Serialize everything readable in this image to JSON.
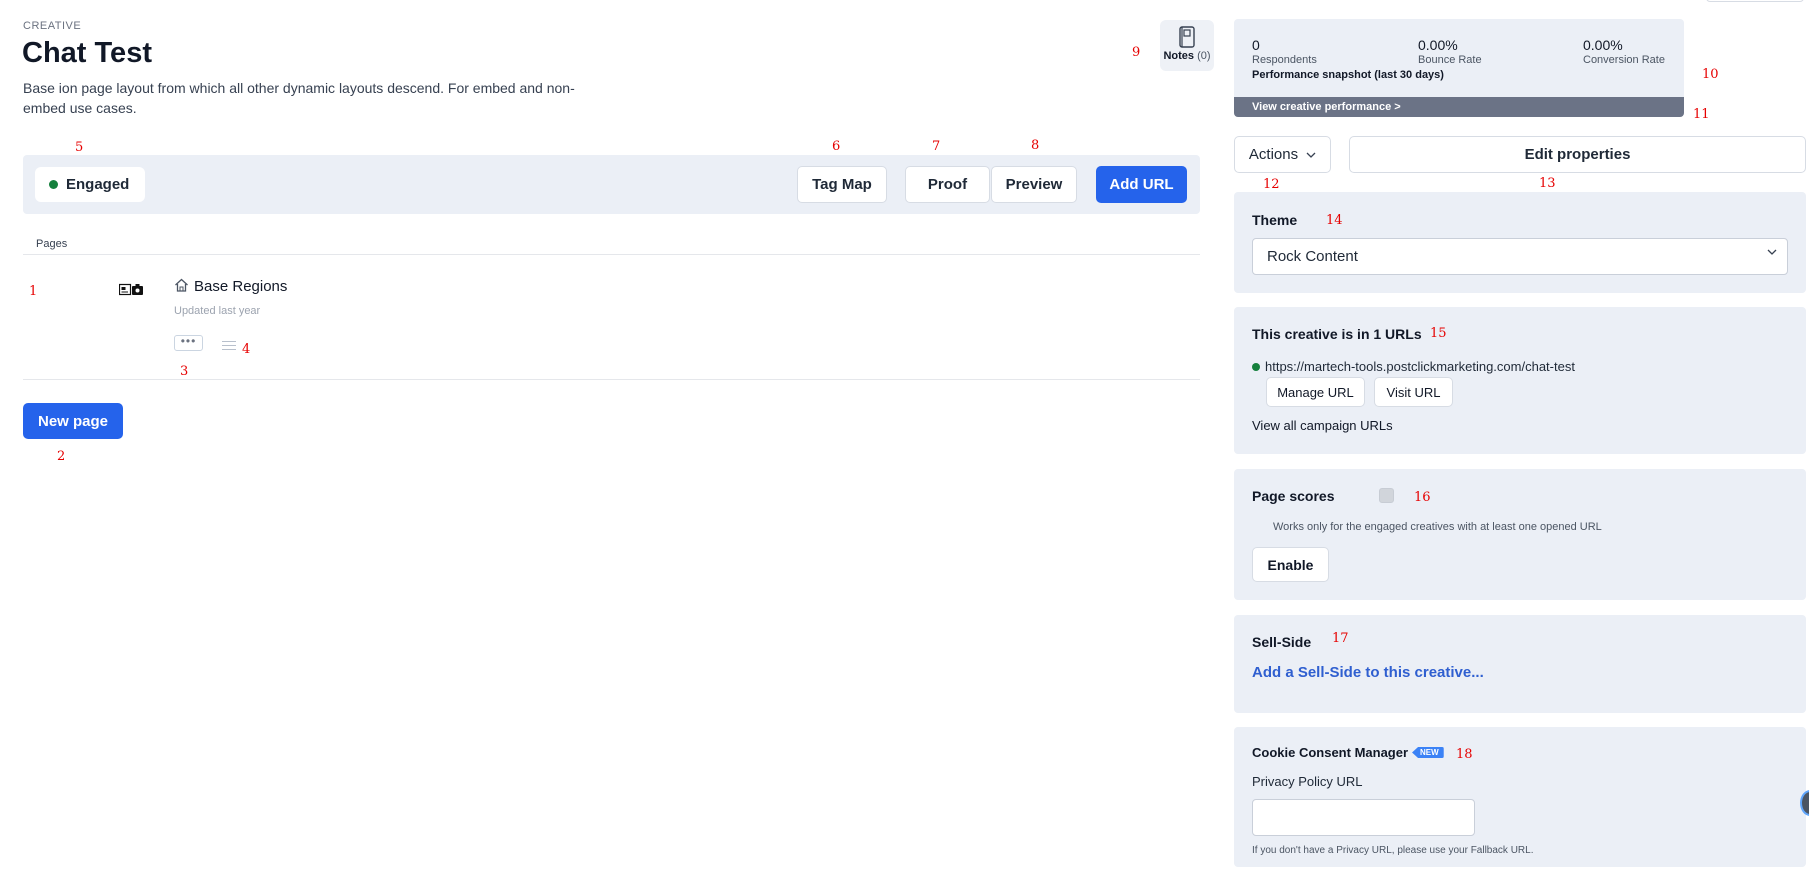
{
  "header": {
    "eyebrow": "CREATIVE",
    "title": "Chat Test",
    "description": "Base ion page layout from which all other dynamic layouts descend. For embed and non-embed use cases.",
    "notes_label": "Notes",
    "notes_count": "(0)"
  },
  "toolbar": {
    "status": "Engaged",
    "tag_map": "Tag Map",
    "proof": "Proof",
    "preview": "Preview",
    "add_url": "Add URL"
  },
  "pages": {
    "section_label": "Pages",
    "items": [
      {
        "name": "Base Regions",
        "updated": "Updated last year"
      }
    ],
    "new_page": "New page"
  },
  "performance": {
    "stats": [
      {
        "value": "0",
        "label": "Respondents"
      },
      {
        "value": "0.00%",
        "label": "Bounce Rate"
      },
      {
        "value": "0.00%",
        "label": "Conversion Rate"
      }
    ],
    "title": "Performance snapshot (last 30 days)",
    "link": "View creative performance >"
  },
  "actions": {
    "label": "Actions",
    "edit_properties": "Edit properties"
  },
  "theme": {
    "title": "Theme",
    "selected": "Rock Content"
  },
  "urls": {
    "title": "This creative is in 1 URLs",
    "url": "https://martech-tools.postclickmarketing.com/chat-test",
    "manage": "Manage URL",
    "visit": "Visit URL",
    "view_all": "View all campaign URLs"
  },
  "page_scores": {
    "title": "Page scores",
    "note": "Works only for the engaged creatives with at least one opened URL",
    "enable": "Enable"
  },
  "sell_side": {
    "title": "Sell-Side",
    "link": "Add a Sell-Side to this creative..."
  },
  "cookie": {
    "title": "Cookie Consent Manager",
    "badge": "NEW",
    "field_label": "Privacy Policy URL",
    "field_value": "",
    "hint": "If you don't have a Privacy URL, please use your Fallback URL."
  },
  "markers": [
    "1",
    "2",
    "3",
    "4",
    "5",
    "6",
    "7",
    "8",
    "9",
    "10",
    "11",
    "12",
    "13",
    "14",
    "15",
    "16",
    "17",
    "18"
  ],
  "colors": {
    "primary": "#2563eb",
    "panel_bg": "#ebeff6",
    "status_green": "#15803d",
    "marker_red": "#e60000"
  }
}
